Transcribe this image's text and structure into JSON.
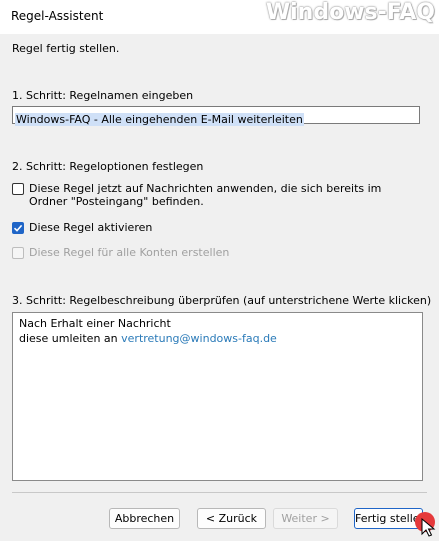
{
  "window": {
    "title": "Regel-Assistent",
    "watermark": "Windows-FAQ"
  },
  "page": {
    "heading": "Regel fertig stellen.",
    "step1_label": "1. Schritt: Regelnamen eingeben",
    "rule_name_value": "Windows-FAQ - Alle eingehenden E-Mail weiterleiten",
    "step2_label": "2. Schritt: Regeloptionen festlegen",
    "options": [
      {
        "label": "Diese Regel jetzt auf Nachrichten anwenden, die sich bereits im Ordner \"Posteingang\" befinden.",
        "checked": false,
        "enabled": true
      },
      {
        "label": "Diese Regel aktivieren",
        "checked": true,
        "enabled": true
      },
      {
        "label": "Diese Regel für alle Konten erstellen",
        "checked": false,
        "enabled": false
      }
    ],
    "step3_label": "3. Schritt: Regelbeschreibung überprüfen (auf unterstrichene Werte klicken)",
    "description": {
      "line1": "Nach Erhalt einer Nachricht",
      "line2_prefix": "diese umleiten an",
      "line2_link": "vertretung@windows-faq.de"
    }
  },
  "buttons": {
    "cancel": "Abbrechen",
    "back": "< Zurück",
    "next": "Weiter >",
    "finish": "Fertig stellen"
  },
  "colors": {
    "accent": "#1f65c7",
    "link": "#2a7ab8",
    "cursor": "#e5393b"
  }
}
